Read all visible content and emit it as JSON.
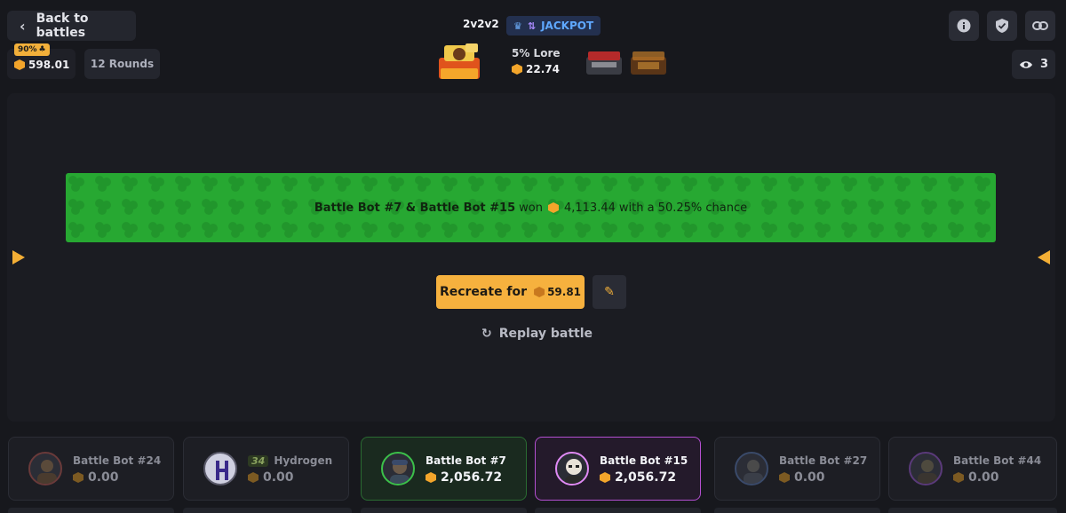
{
  "header": {
    "back_label": "Back to battles",
    "balance_badge": "90%",
    "balance": "598.01",
    "rounds": "12 Rounds",
    "mode": "2v2v2",
    "jackpot_label": "JACKPOT",
    "viewers": "3"
  },
  "cases": {
    "featured_name": "5% Lore",
    "featured_price": "22.74"
  },
  "banner": {
    "winners": "Battle Bot #7 & Battle Bot #15",
    "won_word": "won",
    "amount": "4,113.44",
    "chance_text": "with a 50.25% chance"
  },
  "actions": {
    "recreate_label": "Recreate for",
    "recreate_price": "59.81",
    "replay_label": "Replay battle"
  },
  "players": [
    {
      "name": "Battle Bot #24",
      "amount": "0.00",
      "level": ""
    },
    {
      "name": "Hydrogen",
      "amount": "0.00",
      "level": "34"
    },
    {
      "name": "Battle Bot #7",
      "amount": "2,056.72",
      "level": ""
    },
    {
      "name": "Battle Bot #15",
      "amount": "2,056.72",
      "level": ""
    },
    {
      "name": "Battle Bot #27",
      "amount": "0.00",
      "level": ""
    },
    {
      "name": "Battle Bot #44",
      "amount": "0.00",
      "level": ""
    }
  ],
  "colors": {
    "accent": "#f6b13e",
    "win_green": "#27a832",
    "team_purple": "#b34fd0",
    "background": "#17181d"
  }
}
